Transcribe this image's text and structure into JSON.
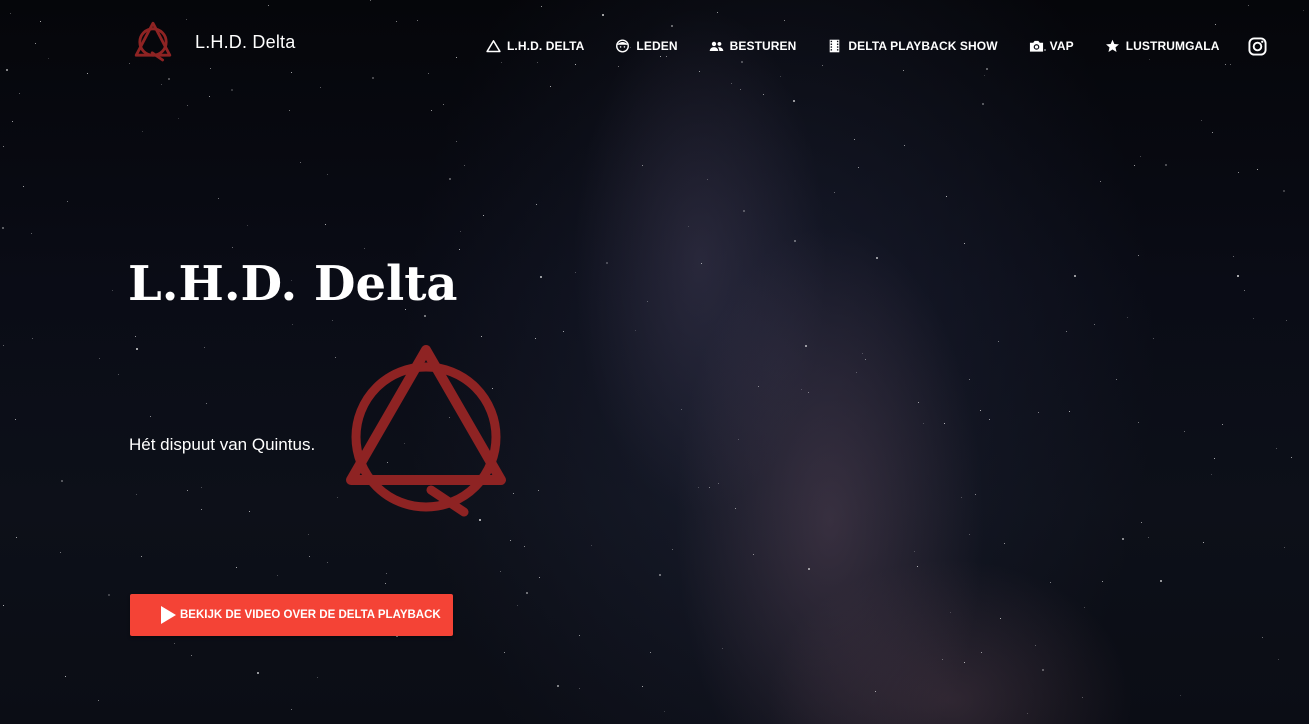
{
  "brand": {
    "name": "L.H.D. Delta",
    "logo_icon": "delta-emblem-icon",
    "accent_color": "#8e2323"
  },
  "nav": {
    "items": [
      {
        "label": "L.H.D. DELTA",
        "icon": "triangle-icon"
      },
      {
        "label": "LEDEN",
        "icon": "face-icon"
      },
      {
        "label": "BESTUREN",
        "icon": "people-icon"
      },
      {
        "label": "DELTA PLAYBACK SHOW",
        "icon": "film-icon"
      },
      {
        "label": "VAP",
        "icon": "camera-icon"
      },
      {
        "label": "LUSTRUMGALA",
        "icon": "star-icon"
      }
    ],
    "social_icon": "instagram-icon"
  },
  "hero": {
    "title": "L.H.D. Delta",
    "subtitle": "Hét dispuut van Quintus.",
    "emblem_icon": "delta-emblem-icon",
    "cta_label": "BEKIJK DE VIDEO OVER DE DELTA PLAYBACK",
    "cta_icon": "play-icon",
    "cta_color": "#f44336"
  }
}
